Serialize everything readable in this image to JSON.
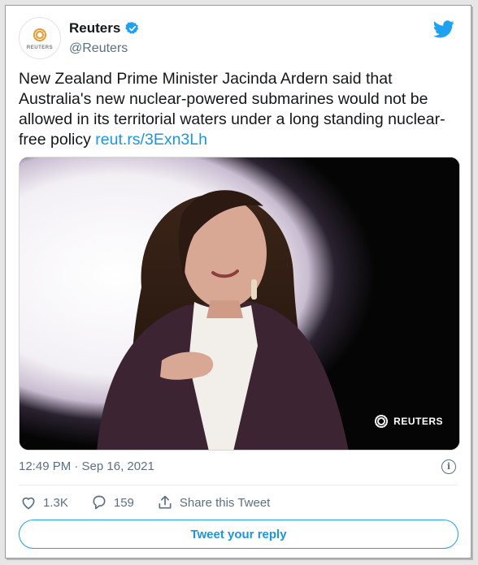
{
  "account": {
    "name": "Reuters",
    "handle": "@Reuters",
    "avatar_wordmark": "REUTERS"
  },
  "tweet": {
    "text": "New Zealand Prime Minister Jacinda Ardern said that Australia's new nuclear-powered submarines would not be allowed in its territorial waters under a long standing nuclear-free policy ",
    "link": "reut.rs/3Exn3Lh",
    "image_watermark": "REUTERS",
    "timestamp": "12:49 PM · Sep 16, 2021"
  },
  "actions": {
    "likes": "1.3K",
    "replies": "159",
    "share_label": "Share this Tweet"
  },
  "reply_button": "Tweet your reply",
  "colors": {
    "brand": "#1da1f2",
    "link": "#1b95e0",
    "secondary_text": "#5b7083"
  },
  "icons": [
    "twitter-bird-icon",
    "verified-badge-icon",
    "info-icon",
    "heart-icon",
    "reply-bubble-icon",
    "share-icon"
  ]
}
